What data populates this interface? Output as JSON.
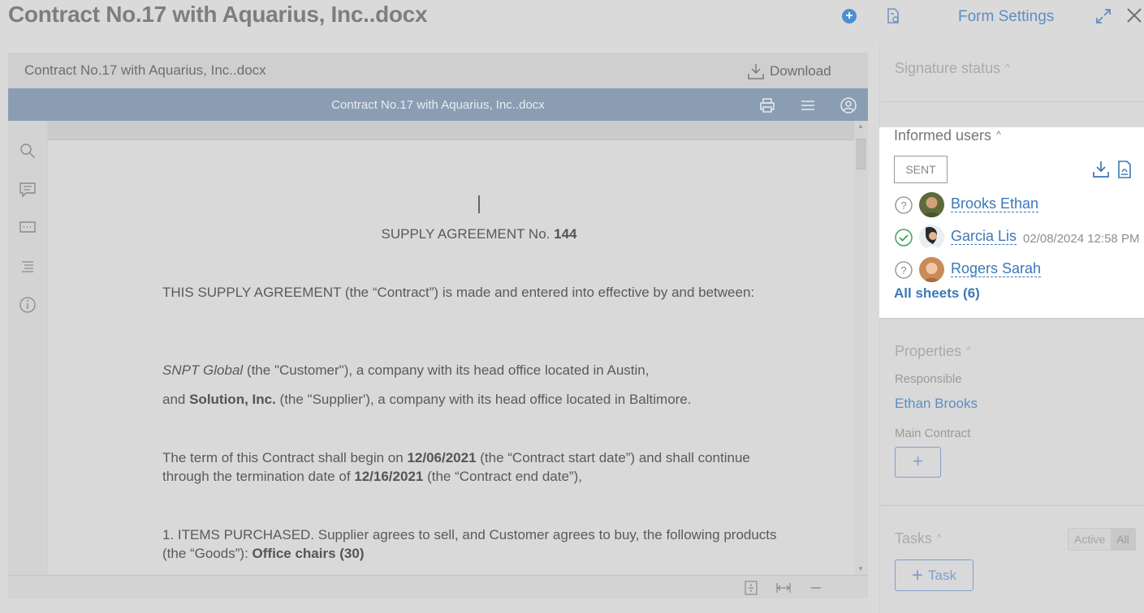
{
  "header": {
    "title": "Contract No.17 with Aquarius, Inc..docx",
    "form_settings": "Form Settings",
    "plus_glyph": "+"
  },
  "viewer": {
    "file_name": "Contract No.17 with Aquarius, Inc..docx",
    "download_label": "Download",
    "doc_bar_title": "Contract No.17 with Aquarius, Inc..docx"
  },
  "document": {
    "heading_text": "SUPPLY AGREEMENT No.",
    "heading_number": "144",
    "p1": "THIS SUPPLY AGREEMENT (the “Contract”) is made and entered into effective by and between:",
    "p2_italic": "SNPT Global",
    "p2_rest": " (the \"Customer\"), a company with its head office located in Austin,",
    "p3_pre": "and ",
    "p3_bold": "Solution, Inc.",
    "p3_rest": " (the \"Supplier'), a company with its head office located in Baltimore.",
    "p4_a": "The term of this Contract shall begin on ",
    "p4_date1": "12/06/2021",
    "p4_b": " (the “Contract start date”) and shall continue through the termination date of ",
    "p4_date2": "12/16/2021",
    "p4_c": " (the “Contract end date”),",
    "p5_a": "1. ITEMS PURCHASED. Supplier agrees to sell, and Customer agrees to buy, the following products (the “Goods”): ",
    "p5_bold": "Office chairs (30)"
  },
  "signature_status": {
    "title": "Signature status",
    "chevron": "^"
  },
  "informed_users": {
    "title": "Informed users",
    "chevron": "^",
    "sent_label": "SENT",
    "users": [
      {
        "name": "Brooks Ethan",
        "status": "pending",
        "date": ""
      },
      {
        "name": "Garcia Lis",
        "status": "confirmed",
        "date": "02/08/2024 12:58 PM"
      },
      {
        "name": "Rogers Sarah",
        "status": "pending",
        "date": ""
      }
    ],
    "all_sheets": "All sheets (6)"
  },
  "properties": {
    "title": "Properties",
    "chevron": "^",
    "responsible_label": "Responsible",
    "responsible_value": "Ethan Brooks",
    "main_contract_label": "Main Contract",
    "add_glyph": "+"
  },
  "tasks": {
    "title": "Tasks",
    "chevron": "^",
    "filter_active": "Active",
    "filter_all": "All",
    "add_task_label": "Task",
    "add_glyph": "+"
  },
  "colors": {
    "accent": "#3b78b6",
    "link": "#5d8ec4",
    "doc_bar": "#8a9db3",
    "confirmed": "#3aa65a"
  }
}
